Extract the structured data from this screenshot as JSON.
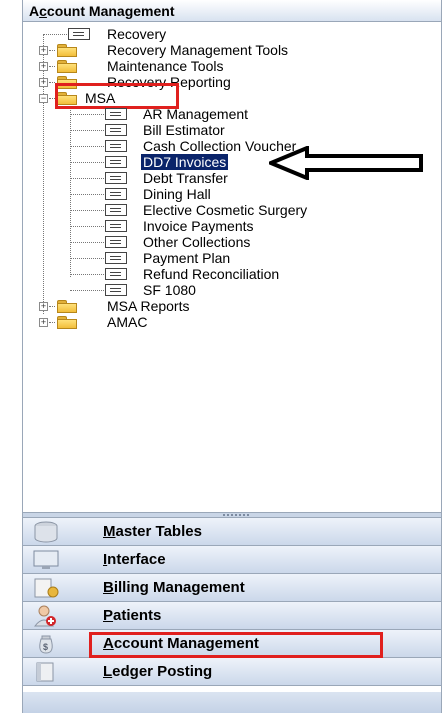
{
  "header": {
    "title_first": "A",
    "title_underlined": "c",
    "title_rest": "count Management"
  },
  "tree": {
    "items": [
      {
        "label": "Recovery",
        "type": "doc"
      },
      {
        "label": "Recovery Management Tools",
        "type": "folder"
      },
      {
        "label": "Maintenance Tools",
        "type": "folder"
      },
      {
        "label": "Recovery Reporting",
        "type": "folder"
      },
      {
        "label": "MSA",
        "type": "folder",
        "expanded": true
      },
      {
        "label": "AR Management",
        "type": "doc"
      },
      {
        "label": "Bill Estimator",
        "type": "doc"
      },
      {
        "label": "Cash Collection Voucher",
        "type": "doc"
      },
      {
        "label": "DD7 Invoices",
        "type": "doc",
        "selected": true
      },
      {
        "label": "Debt Transfer",
        "type": "doc"
      },
      {
        "label": "Dining Hall",
        "type": "doc"
      },
      {
        "label": "Elective Cosmetic Surgery",
        "type": "doc"
      },
      {
        "label": "Invoice Payments",
        "type": "doc"
      },
      {
        "label": "Other Collections",
        "type": "doc"
      },
      {
        "label": "Payment Plan",
        "type": "doc"
      },
      {
        "label": "Refund Reconciliation",
        "type": "doc"
      },
      {
        "label": "SF 1080",
        "type": "doc"
      },
      {
        "label": "MSA Reports",
        "type": "folder"
      },
      {
        "label": "AMAC",
        "type": "folder"
      }
    ]
  },
  "nav": {
    "buttons": [
      {
        "underline": "M",
        "rest": "aster Tables",
        "icon": "database-icon"
      },
      {
        "underline": "I",
        "rest": "nterface",
        "icon": "monitor-icon"
      },
      {
        "underline": "B",
        "rest": "illing Management",
        "icon": "billing-icon"
      },
      {
        "underline": "P",
        "rest": "atients",
        "icon": "patient-icon"
      },
      {
        "underline": "A",
        "rest": "ccount Management",
        "icon": "money-bag-icon"
      },
      {
        "underline": "L",
        "rest": "edger Posting",
        "icon": "ledger-icon"
      }
    ]
  },
  "annotations": {
    "highlight_color": "#e0201e",
    "selected_color": "#0a246a"
  }
}
